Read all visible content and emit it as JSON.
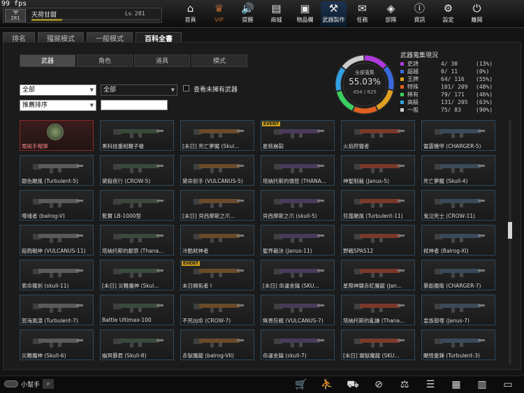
{
  "fps": "99 fps",
  "player": {
    "rank": "281",
    "name": "天荷甘甜",
    "level": "Lv. 281",
    "xp_fraction": 0.24
  },
  "nav": [
    {
      "label": "首頁",
      "icon": "home-icon",
      "glyph": "⌂"
    },
    {
      "label": "VIP",
      "icon": "crown-icon",
      "glyph": "♛"
    },
    {
      "label": "提醒",
      "icon": "speaker-icon",
      "glyph": "🔊"
    },
    {
      "label": "商城",
      "icon": "shop-icon",
      "glyph": "▤"
    },
    {
      "label": "物品欄",
      "icon": "bag-icon",
      "glyph": "▣"
    },
    {
      "label": "武器製作",
      "icon": "wrench-icon",
      "glyph": "⚒"
    },
    {
      "label": "任務",
      "icon": "ticket-icon",
      "glyph": "✉"
    },
    {
      "label": "部隊",
      "icon": "shield-icon",
      "glyph": "◈"
    },
    {
      "label": "資訊",
      "icon": "info-icon",
      "glyph": "ⓘ"
    },
    {
      "label": "設定",
      "icon": "gear-icon",
      "glyph": "⚙"
    },
    {
      "label": "離開",
      "icon": "power-icon",
      "glyph": "⏻"
    }
  ],
  "tabs": [
    "排名",
    "殭屍模式",
    "一般模式",
    "百科全書"
  ],
  "subtabs": [
    "武器",
    "角色",
    "道具",
    "模式"
  ],
  "filters": {
    "category": "全部",
    "subcategory": "全部",
    "sort": "推薦排序",
    "search": "",
    "unowned_label": "查看未擁有武器"
  },
  "collection": {
    "title": "全部蒐集",
    "percent": "55.03%",
    "count": "454 / 825",
    "stats_title": "武器蒐集現況",
    "tiers": [
      {
        "name": "史詩",
        "value": "4/  30",
        "pct": "(13%)",
        "color": "#b03adf"
      },
      {
        "name": "超越",
        "value": "0/  11",
        "pct": "(0%)",
        "color": "#3a6adf"
      },
      {
        "name": "王牌",
        "value": "64/ 116",
        "pct": "(55%)",
        "color": "#e0a020"
      },
      {
        "name": "特殊",
        "value": "101/ 209",
        "pct": "(48%)",
        "color": "#e06020"
      },
      {
        "name": "稀有",
        "value": "79/ 171",
        "pct": "(46%)",
        "color": "#3ad060"
      },
      {
        "name": "高級",
        "value": "131/ 205",
        "pct": "(63%)",
        "color": "#30a0e0"
      },
      {
        "name": "一般",
        "value": "75/  83",
        "pct": "(90%)",
        "color": "#cccccc"
      }
    ]
  },
  "weapons": [
    {
      "name": "電磁手榴彈",
      "event": ""
    },
    {
      "name": "黑科技重組離子槍",
      "event": ""
    },
    {
      "name": "[末日] 死亡夢魘 (Skul...",
      "event": ""
    },
    {
      "name": "星核崩裂",
      "event": "EVENT"
    },
    {
      "name": "火焰狩獵者",
      "event": ""
    },
    {
      "name": "雷霆機甲 (CHARGER-5)",
      "event": ""
    },
    {
      "name": "銀色颶風 (Turbulent-5)",
      "event": ""
    },
    {
      "name": "黛殺夜行 (CROW-5)",
      "event": ""
    },
    {
      "name": "黛命射手 (VULCANUS-5)",
      "event": ""
    },
    {
      "name": "塔納托斯的憤怒 (THANA...",
      "event": ""
    },
    {
      "name": "神聖制裁 (Janus-5)",
      "event": ""
    },
    {
      "name": "死亡夢魘 (Skull-4)",
      "event": ""
    },
    {
      "name": "噬魂者 (balrog-V)",
      "event": ""
    },
    {
      "name": "藍寶 LB-1000型",
      "event": ""
    },
    {
      "name": "[末日] 貝西摩斯之爪...",
      "event": ""
    },
    {
      "name": "貝西摩斯之爪 (skull-5)",
      "event": ""
    },
    {
      "name": "狂嵐颶風 (Turbulent-11)",
      "event": ""
    },
    {
      "name": "鬼泣死士 (CROW-11)",
      "event": ""
    },
    {
      "name": "殺戮戰神 (VULCANUS-11)",
      "event": ""
    },
    {
      "name": "塔納托斯的獻祭 (Thana...",
      "event": ""
    },
    {
      "name": "冷酷弒神者",
      "event": ""
    },
    {
      "name": "聖界裁決 (Janus-11)",
      "event": ""
    },
    {
      "name": "野戰SPAS12",
      "event": ""
    },
    {
      "name": "弒神者 (Balrog-XI)",
      "event": ""
    },
    {
      "name": "索命羅剎 (skull-11)",
      "event": ""
    },
    {
      "name": "[末日] 災難魔神 (Skul...",
      "event": ""
    },
    {
      "name": "末日開拓者 I",
      "event": "EVENT"
    },
    {
      "name": "[末日] 命運金鑰 (SKU...",
      "event": ""
    },
    {
      "name": "星際神鑄赤紅魔龍 (Jan...",
      "event": ""
    },
    {
      "name": "暴能艦衛 (CHARGER-7)",
      "event": ""
    },
    {
      "name": "怒海風濤 (Turbulent-7)",
      "event": ""
    },
    {
      "name": "Battle Ultimax-100",
      "event": ""
    },
    {
      "name": "不死凶命 (CROW-7)",
      "event": ""
    },
    {
      "name": "無畏狂戰 (VULCANUS-7)",
      "event": ""
    },
    {
      "name": "塔納托斯的亂鎌 (Thana...",
      "event": ""
    },
    {
      "name": "皇族鬃噬 (Janus-7)",
      "event": ""
    },
    {
      "name": "災難魔神 (Skull-6)",
      "event": ""
    },
    {
      "name": "幽冥暴君 (Skull-8)",
      "event": ""
    },
    {
      "name": "赤獄魔龍 (balrog-VII)",
      "event": ""
    },
    {
      "name": "命運金鑰 (skull-7)",
      "event": ""
    },
    {
      "name": "[末日] 闇獄魔龍 (SKU...",
      "event": ""
    },
    {
      "name": "颶怪重錘 (Turbulent-3)",
      "event": ""
    }
  ],
  "helper": {
    "label": "小幫手"
  },
  "bottom_tools": [
    {
      "icon": "cart-icon",
      "glyph": "🛒"
    },
    {
      "icon": "runner-icon",
      "glyph": "⛹"
    },
    {
      "icon": "basket-icon",
      "glyph": "⛟"
    },
    {
      "icon": "compass-icon",
      "glyph": "⊘"
    },
    {
      "icon": "scale-icon",
      "glyph": "⚖"
    },
    {
      "icon": "checklist-icon",
      "glyph": "☰"
    },
    {
      "icon": "book-icon",
      "glyph": "▦"
    },
    {
      "icon": "calendar-icon",
      "glyph": "▥"
    },
    {
      "icon": "film-icon",
      "glyph": "▭"
    }
  ]
}
